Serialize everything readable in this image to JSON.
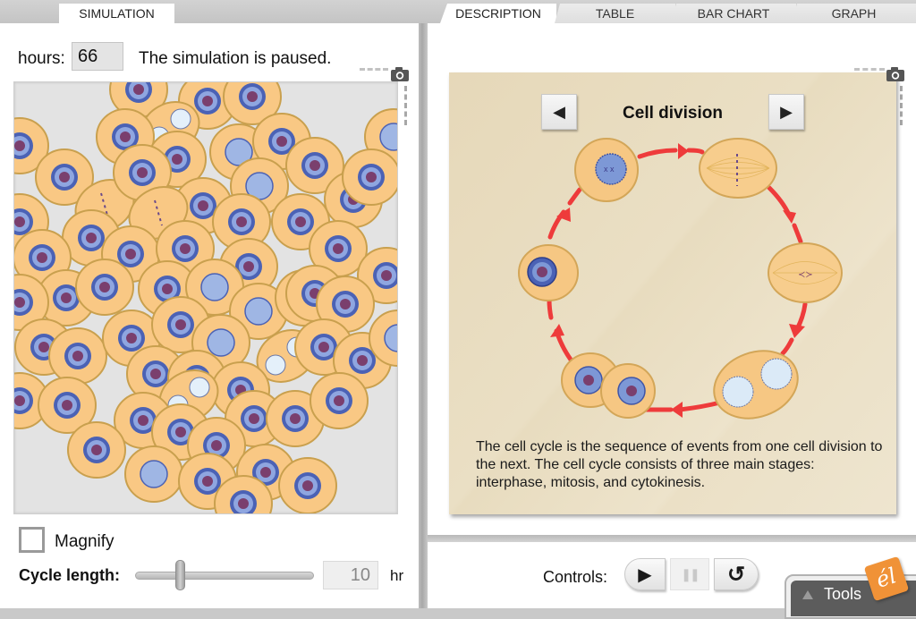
{
  "tabs_left": [
    {
      "label": "SIMULATION",
      "active": true
    }
  ],
  "tabs_right": [
    {
      "label": "DESCRIPTION",
      "active": true
    },
    {
      "label": "TABLE",
      "active": false
    },
    {
      "label": "BAR CHART",
      "active": false
    },
    {
      "label": "GRAPH",
      "active": false
    }
  ],
  "simulation": {
    "hours_label": "hours:",
    "hours_value": "66",
    "status": "The simulation is paused.",
    "camera_icon": "camera-icon",
    "cells": {
      "interphase_count_visible": 64,
      "description": "Field of yellow-orange cells with blue nuclei in various stages of the cell cycle"
    }
  },
  "options": {
    "magnify_label": "Magnify",
    "magnify_checked": false,
    "cycle_label": "Cycle length:",
    "cycle_value": "10",
    "cycle_unit": "hr",
    "slider_fraction": 0.25
  },
  "description": {
    "title": "Cell division",
    "prev_icon": "◀",
    "next_icon": "▶",
    "camera_icon": "camera-icon",
    "text": "The cell cycle is the sequence of events from one cell division to the next. The cell cycle consists of three main stages: interphase, mitosis, and cytokinesis.",
    "stages": [
      "prophase",
      "metaphase",
      "anaphase",
      "telophase",
      "cytokinesis",
      "interphase"
    ]
  },
  "controls": {
    "label": "Controls:",
    "play_icon": "▶",
    "pause_icon": "❚❚",
    "reset_icon": "↺"
  },
  "tools": {
    "label": "Tools",
    "logo_text": "él"
  },
  "colors": {
    "cell_fill": "#f9c884",
    "cell_border": "#c9a04e",
    "nucleus_outer": "#4b62b5",
    "nucleus_inner": "#8fa6e0",
    "chromatin": "#7a3f6e",
    "arrow_red": "#ee3b3b",
    "card_bg": "#e9ddc2",
    "logo_orange": "#f09237"
  }
}
